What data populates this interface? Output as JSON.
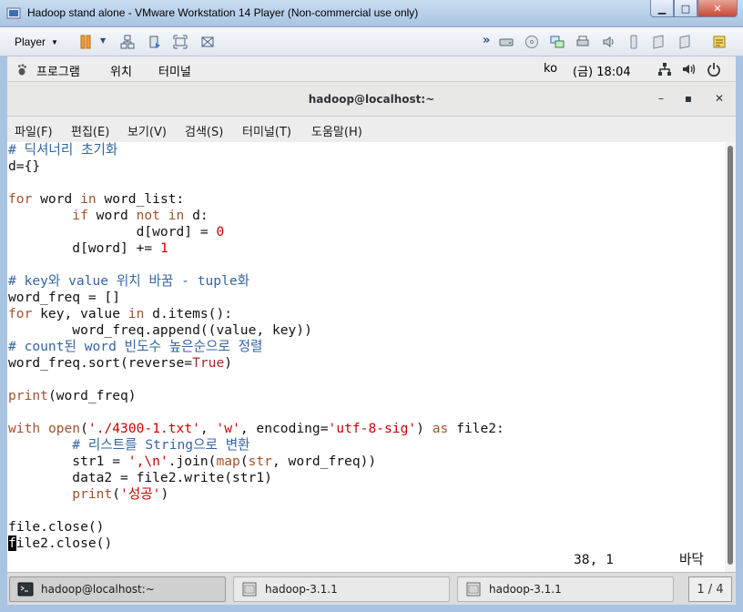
{
  "vm": {
    "title": "Hadoop stand alone - VMware Workstation 14 Player (Non-commercial use only)",
    "player_label": "Player",
    "min_glyph": "▁",
    "max_glyph": "□",
    "close_glyph": "✕"
  },
  "gnome": {
    "apps": "프로그램",
    "places": "위치",
    "terminal": "터미널",
    "input_method": "ko",
    "clock": "(금) 18:04"
  },
  "terminal": {
    "title": "hadoop@localhost:~",
    "min_glyph": "–",
    "max_glyph": "▪",
    "close_glyph": "✕",
    "menu": [
      "파일(F)",
      "편집(E)",
      "보기(V)",
      "검색(S)",
      "터미널(T)",
      "도움말(H)"
    ],
    "code": {
      "l1": "# 딕셔너리 초기화",
      "l2": "d={}",
      "l4a": "for",
      "l4b": " word ",
      "l4c": "in",
      "l4d": " word_list:",
      "l5a": "        ",
      "l5b": "if",
      "l5c": " word ",
      "l5d": "not in",
      "l5e": " d:",
      "l6a": "                d[word] = ",
      "l6b": "0",
      "l7a": "        d[word] += ",
      "l7b": "1",
      "l9": "# key와 value 위치 바꿈 - tuple화",
      "l10": "word_freq = []",
      "l11a": "for",
      "l11b": " key, value ",
      "l11c": "in",
      "l11d": " d.items():",
      "l12": "        word_freq.append((value, key))",
      "l13": "# count된 word 빈도수 높은순으로 정렬",
      "l14a": "word_freq.sort(reverse=",
      "l14b": "True",
      "l14c": ")",
      "l16a": "print",
      "l16b": "(word_freq)",
      "l18a": "with",
      "l18b": " ",
      "l18c": "open",
      "l18d": "(",
      "l18e": "'./4300-1.txt'",
      "l18f": ", ",
      "l18g": "'w'",
      "l18h": ", encoding=",
      "l18i": "'utf-8-sig'",
      "l18j": ") ",
      "l18k": "as",
      "l18l": " file2:",
      "l19": "        # 리스트를 String으로 변환",
      "l20a": "        str1 = ",
      "l20b": "',\\n'",
      "l20c": ".join(",
      "l20d": "map",
      "l20e": "(",
      "l20f": "str",
      "l20g": ", word_freq))",
      "l21": "        data2 = file2.write(str1)",
      "l22a": "        ",
      "l22b": "print",
      "l22c": "(",
      "l22d": "'성공'",
      "l22e": ")",
      "l24": "file.close()",
      "l25a": "f",
      "l25b": "ile2.close()"
    },
    "cursor_pos": "38, 1",
    "scroll_pos": "바닥"
  },
  "taskbar": {
    "items": [
      {
        "label": "hadoop@localhost:~"
      },
      {
        "label": "hadoop-3.1.1"
      },
      {
        "label": "hadoop-3.1.1"
      }
    ],
    "workspace": "1 / 4"
  }
}
